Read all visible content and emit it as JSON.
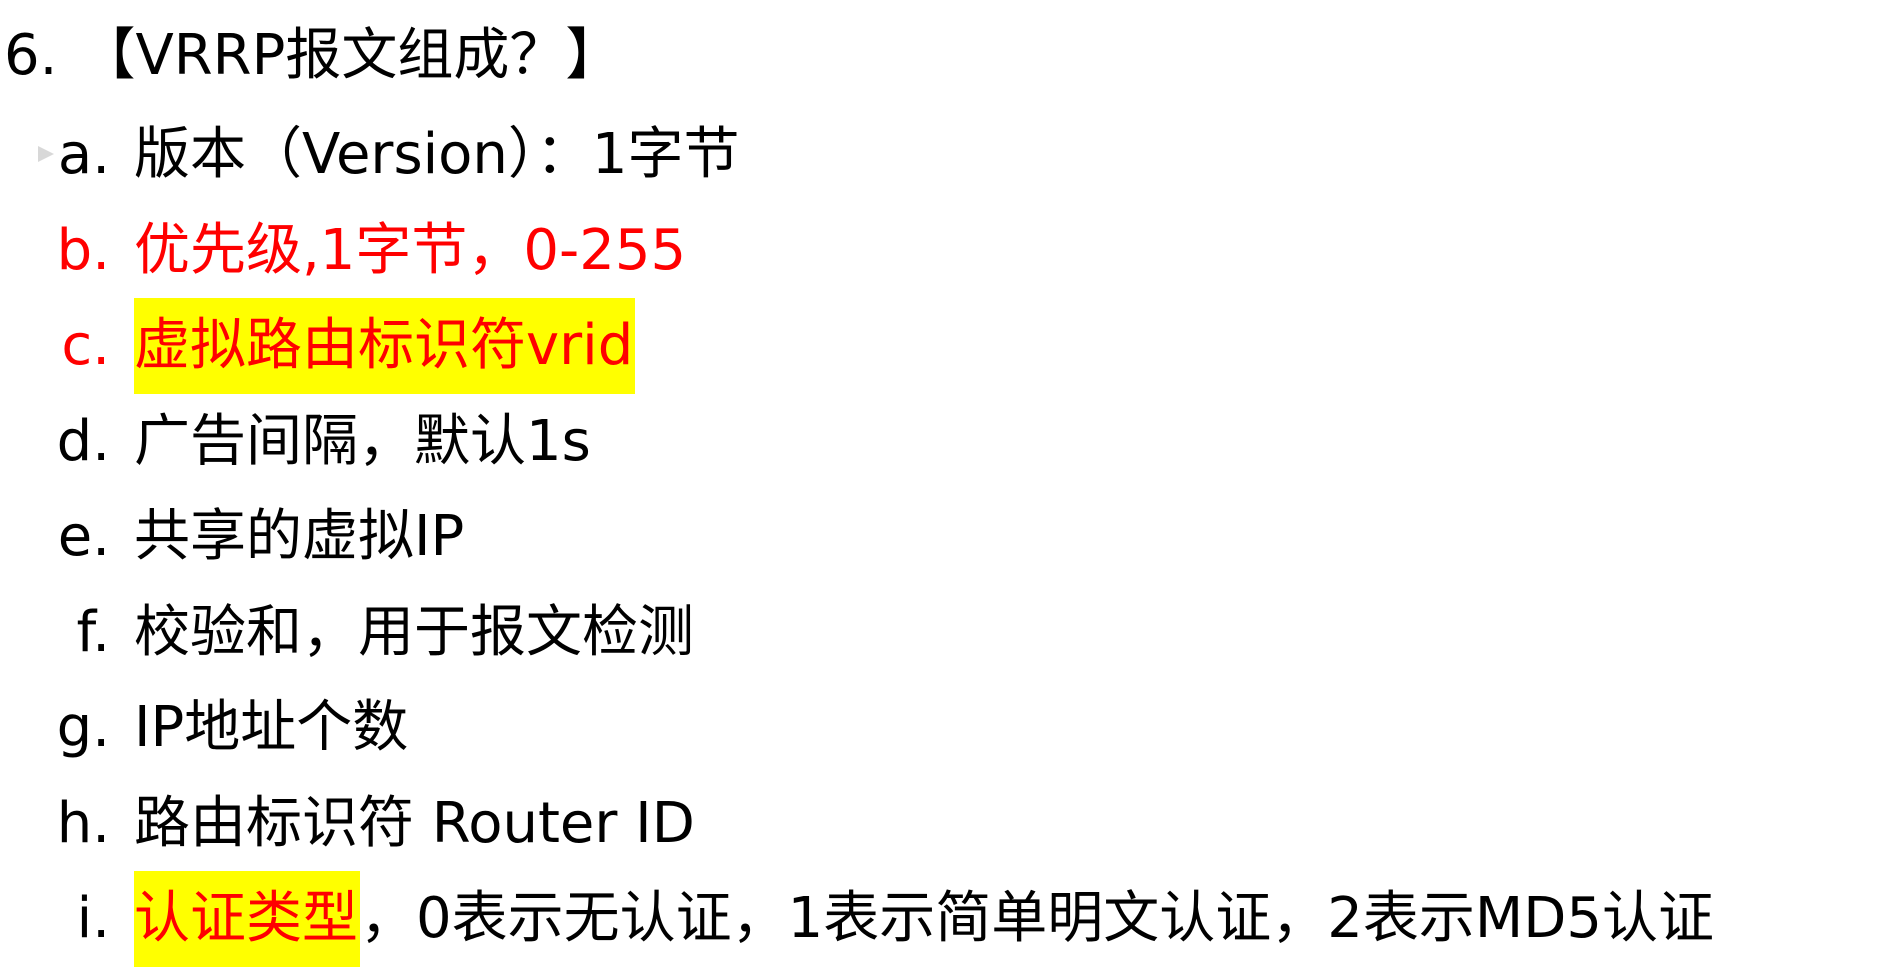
{
  "heading": {
    "number": "6.",
    "text": "【VRRP报文组成？】"
  },
  "items": [
    {
      "marker": "a.",
      "text": "版本（Version）：1字节",
      "highlight_text": "",
      "rest": ""
    },
    {
      "marker": "b.",
      "text": "优先级,1字节，0-255",
      "highlight_text": "",
      "rest": ""
    },
    {
      "marker": "c.",
      "text": "",
      "highlight_text": "虚拟路由标识符vrid",
      "rest": ""
    },
    {
      "marker": "d.",
      "text": "广告间隔，默认1s",
      "highlight_text": "",
      "rest": ""
    },
    {
      "marker": "e.",
      "text": "共享的虚拟IP",
      "highlight_text": "",
      "rest": ""
    },
    {
      "marker": "f.",
      "text": "校验和，用于报文检测",
      "highlight_text": "",
      "rest": ""
    },
    {
      "marker": "g.",
      "text": "IP地址个数",
      "highlight_text": "",
      "rest": ""
    },
    {
      "marker": "h.",
      "text": "路由标识符 Router ID",
      "highlight_text": "",
      "rest": ""
    },
    {
      "marker": "i.",
      "text": "",
      "highlight_text": "认证类型",
      "rest": "，0表示无认证，1表示简单明文认证，2表示MD5认证"
    }
  ],
  "colors": {
    "red": "#ff0000",
    "highlight": "#ffff00",
    "text": "#000000"
  },
  "icons": {
    "collapse": "collapse-triangle-icon"
  }
}
